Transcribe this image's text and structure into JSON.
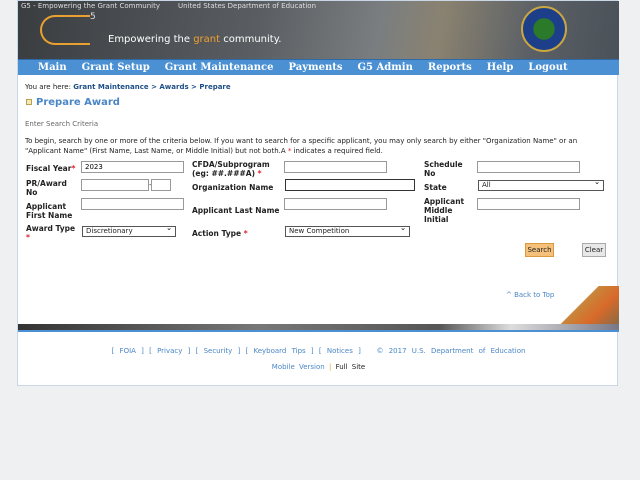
{
  "header": {
    "logo_alt": "G5 - Empowering the Grant Community",
    "seal_alt": "United States Department of Education",
    "logo_sup": "5",
    "tagline_pre": "Empowering the ",
    "tagline_hl": "grant",
    "tagline_post": " community."
  },
  "nav": [
    "Main",
    "Grant Setup",
    "Grant Maintenance",
    "Payments",
    "G5 Admin",
    "Reports",
    "Help",
    "Logout"
  ],
  "breadcrumb": {
    "prefix": "You are here:",
    "path": "Grant Maintenance > Awards > Prepare"
  },
  "page_title": "Prepare Award",
  "section": "Enter Search Criteria",
  "instructions": "To begin, search by one or more of the criteria below. If you want to search for a specific applicant, you may only search by either \"Organization Name\" or an \"Applicant Name\" (First Name, Last Name, or Middle Initial) but not both.A",
  "instructions_tail": "indicates a required field.",
  "form": {
    "fiscal_year": {
      "label": "Fiscal Year",
      "value": "2023"
    },
    "cfda": {
      "label": "CFDA/Subprogram (eg: ##.###A)",
      "value": ""
    },
    "schedule": {
      "label": "Schedule No",
      "value": ""
    },
    "pr_award": {
      "label": "PR/Award No",
      "value": "",
      "suffix": ""
    },
    "org": {
      "label": "Organization Name",
      "value": ""
    },
    "state": {
      "label": "State",
      "value": "All"
    },
    "first": {
      "label": "Applicant First Name",
      "value": ""
    },
    "last": {
      "label": "Applicant Last Name",
      "value": ""
    },
    "middle": {
      "label": "Applicant Middle Initial",
      "value": ""
    },
    "award_type": {
      "label": "Award Type",
      "value": "Discretionary"
    },
    "action_type": {
      "label": "Action Type",
      "value": "New Competition"
    },
    "required_mark": "*"
  },
  "buttons": {
    "search": "Search",
    "clear": "Clear"
  },
  "back_to_top": "^ Back to Top",
  "footer": {
    "links": [
      "FOIA",
      "Privacy",
      "Security",
      "Keyboard Tips",
      "Notices"
    ],
    "copyright": "© 2017 U.S. Department of Education",
    "mobile": "Mobile Version",
    "sep": "|",
    "full": "Full Site"
  },
  "colors": {
    "nav": "#4a90d2",
    "accent": "#4a86c6",
    "required": "#e0202c",
    "search_button": "#f5c07a"
  }
}
